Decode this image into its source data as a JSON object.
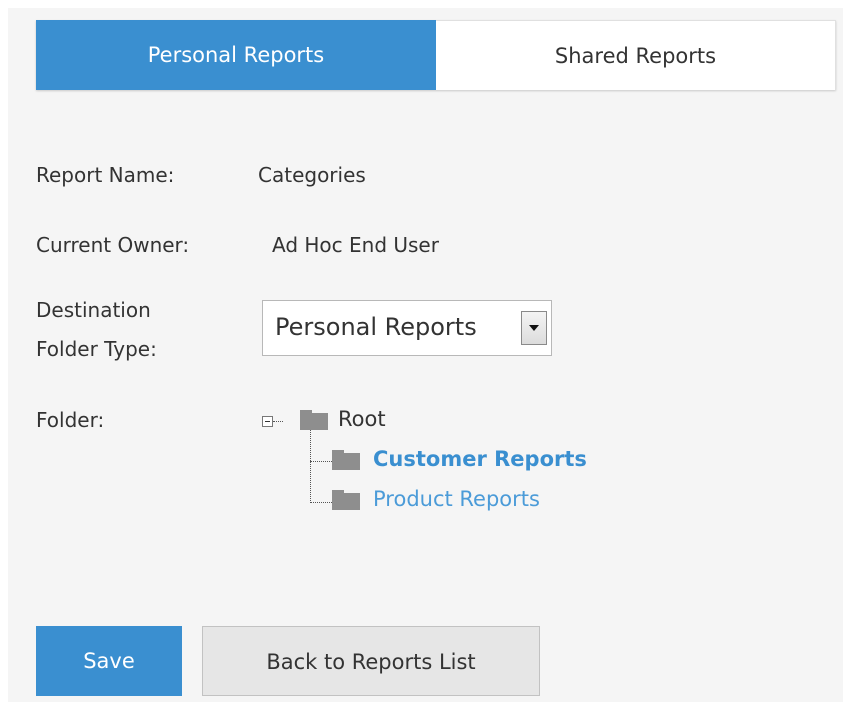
{
  "tabs": {
    "personal": "Personal Reports",
    "shared": "Shared Reports"
  },
  "form": {
    "report_name_label": "Report Name:",
    "report_name_value": "Categories",
    "current_owner_label": "Current Owner:",
    "current_owner_value": "Ad Hoc End User",
    "destination_label_line1": "Destination",
    "destination_label_line2": "Folder Type:",
    "destination_selected": "Personal Reports",
    "folder_label": "Folder:"
  },
  "tree": {
    "root": "Root",
    "children": [
      "Customer Reports",
      "Product Reports"
    ]
  },
  "buttons": {
    "save": "Save",
    "back": "Back to Reports List"
  },
  "colors": {
    "accent": "#3a8fd0",
    "link": "#4b9bd8",
    "panel_background": "#f5f5f5",
    "folder_icon": "#8e8e8e"
  },
  "icons": {
    "folder": "folder-icon",
    "collapse": "tree-collapse-icon",
    "dropdown": "chevron-down-icon"
  }
}
